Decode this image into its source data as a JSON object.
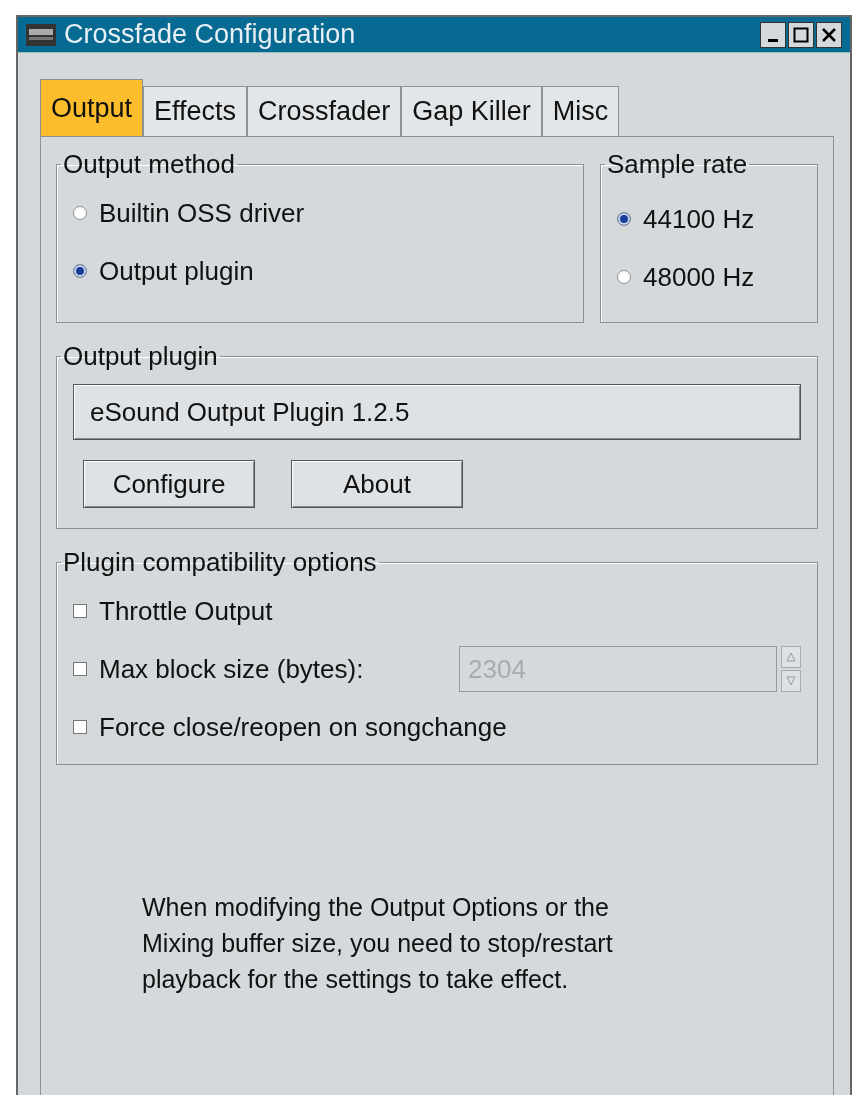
{
  "window": {
    "title": "Crossfade Configuration"
  },
  "tabs": [
    {
      "label": "Output",
      "selected": true
    },
    {
      "label": "Effects",
      "selected": false
    },
    {
      "label": "Crossfader",
      "selected": false
    },
    {
      "label": "Gap Killer",
      "selected": false
    },
    {
      "label": "Misc",
      "selected": false
    }
  ],
  "output_method": {
    "title": "Output method",
    "options": [
      {
        "label": "Builtin OSS driver",
        "selected": false
      },
      {
        "label": "Output plugin",
        "selected": true
      }
    ]
  },
  "sample_rate": {
    "title": "Sample rate",
    "options": [
      {
        "label": "44100 Hz",
        "selected": true
      },
      {
        "label": "48000 Hz",
        "selected": false
      }
    ]
  },
  "output_plugin": {
    "title": "Output plugin",
    "value": "eSound Output Plugin 1.2.5",
    "buttons": [
      "Configure",
      "About"
    ]
  },
  "compatibility": {
    "title": "Plugin compatibility options",
    "options": [
      {
        "kind": "checkbox",
        "label": "Throttle Output",
        "checked": false
      },
      {
        "kind": "spin",
        "label": "Max block size (bytes):",
        "checked": false,
        "value": "2304",
        "disabled": true
      },
      {
        "kind": "checkbox",
        "label": "Force close/reopen on songchange",
        "checked": false
      }
    ]
  },
  "note": "When modifying the Output Options or the Mixing buffer size, you need to stop/restart playback for the settings to take effect."
}
